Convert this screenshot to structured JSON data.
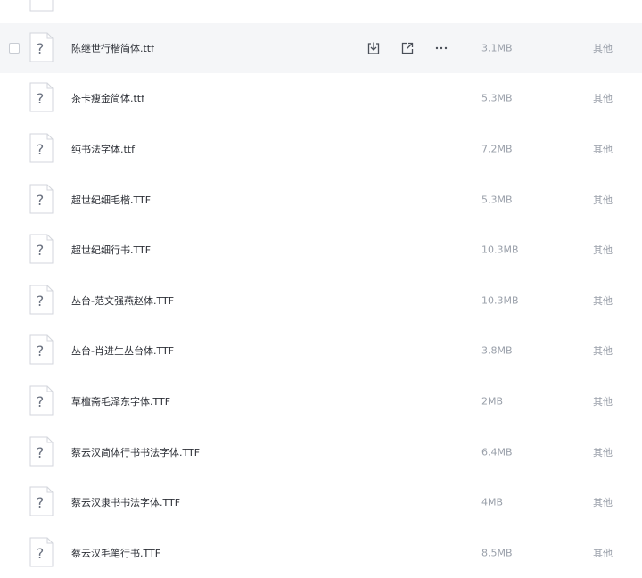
{
  "files": [
    {
      "name": "",
      "size": "",
      "type": ""
    },
    {
      "name": "陈继世行楷简体.ttf",
      "size": "3.1MB",
      "type": "其他",
      "hovered": true
    },
    {
      "name": "茶卡瘦金简体.ttf",
      "size": "5.3MB",
      "type": "其他"
    },
    {
      "name": "纯书法字体.ttf",
      "size": "7.2MB",
      "type": "其他"
    },
    {
      "name": "超世纪细毛楷.TTF",
      "size": "5.3MB",
      "type": "其他"
    },
    {
      "name": "超世纪细行书.TTF",
      "size": "10.3MB",
      "type": "其他"
    },
    {
      "name": "丛台-范文强燕赵体.TTF",
      "size": "10.3MB",
      "type": "其他"
    },
    {
      "name": "丛台-肖进生丛台体.TTF",
      "size": "3.8MB",
      "type": "其他"
    },
    {
      "name": "草檀斋毛泽东字体.TTF",
      "size": "2MB",
      "type": "其他"
    },
    {
      "name": "蔡云汉简体行书书法字体.TTF",
      "size": "6.4MB",
      "type": "其他"
    },
    {
      "name": "蔡云汉隶书书法字体.TTF",
      "size": "4MB",
      "type": "其他"
    },
    {
      "name": "蔡云汉毛笔行书.TTF",
      "size": "8.5MB",
      "type": "其他"
    }
  ],
  "icons": {
    "file": "unknown-file-icon",
    "download": "download-icon",
    "share": "share-icon",
    "more": "more-icon"
  }
}
